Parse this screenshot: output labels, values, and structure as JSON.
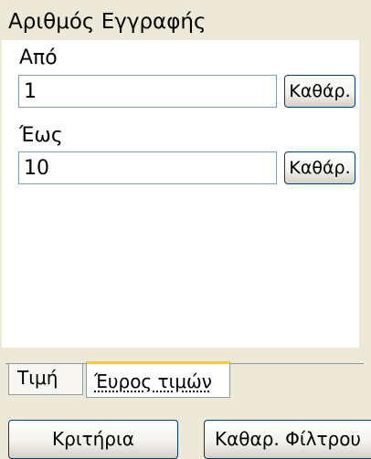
{
  "panel": {
    "title": "Αριθμός Εγγραφής"
  },
  "from": {
    "label": "Από",
    "value": "1",
    "clear_label": "Καθάρ."
  },
  "to": {
    "label": "Έως",
    "value": "10",
    "clear_label": "Καθάρ."
  },
  "tabs": [
    {
      "label": "Τιμή",
      "selected": false
    },
    {
      "label": "Έυρος τιμών",
      "selected": true
    }
  ],
  "footer": {
    "criteria_label": "Κριτήρια",
    "clear_filter_label": "Καθαρ. Φίλτρου"
  },
  "colors": {
    "chrome": "#ece9d8",
    "input_border": "#7f9db9",
    "active_tab_accent": "#ffc83c",
    "button_border": "#003c74"
  }
}
